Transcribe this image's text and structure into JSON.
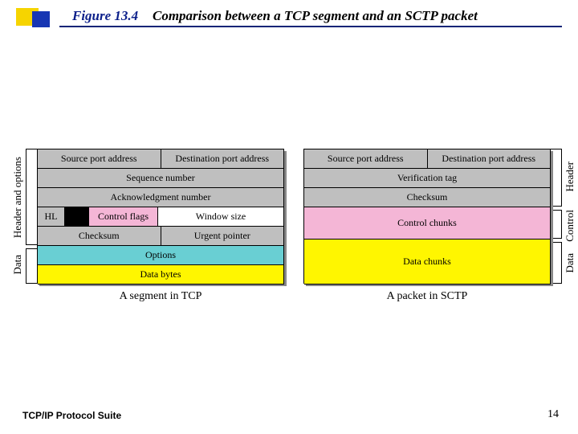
{
  "header": {
    "figure_label": "Figure 13.4",
    "figure_title": "Comparison between a TCP segment and an SCTP packet"
  },
  "tcp": {
    "caption": "A segment in TCP",
    "side_labels": {
      "header": "Header and options",
      "data": "Data"
    },
    "fields": {
      "src_port": "Source port address",
      "dst_port": "Destination port address",
      "seq": "Sequence number",
      "ack": "Acknowledgment number",
      "hl": "HL",
      "flags": "Control flags",
      "winsize": "Window size",
      "checksum": "Checksum",
      "urgent": "Urgent pointer",
      "options": "Options",
      "data": "Data bytes"
    }
  },
  "sctp": {
    "caption": "A packet in SCTP",
    "side_labels": {
      "header": "Header",
      "control": "Control",
      "data": "Data"
    },
    "fields": {
      "src_port": "Source port address",
      "dst_port": "Destination port address",
      "vtag": "Verification tag",
      "checksum": "Checksum",
      "control_chunks": "Control chunks",
      "data_chunks": "Data chunks"
    }
  },
  "footer": {
    "left": "TCP/IP Protocol Suite",
    "page": "14"
  }
}
